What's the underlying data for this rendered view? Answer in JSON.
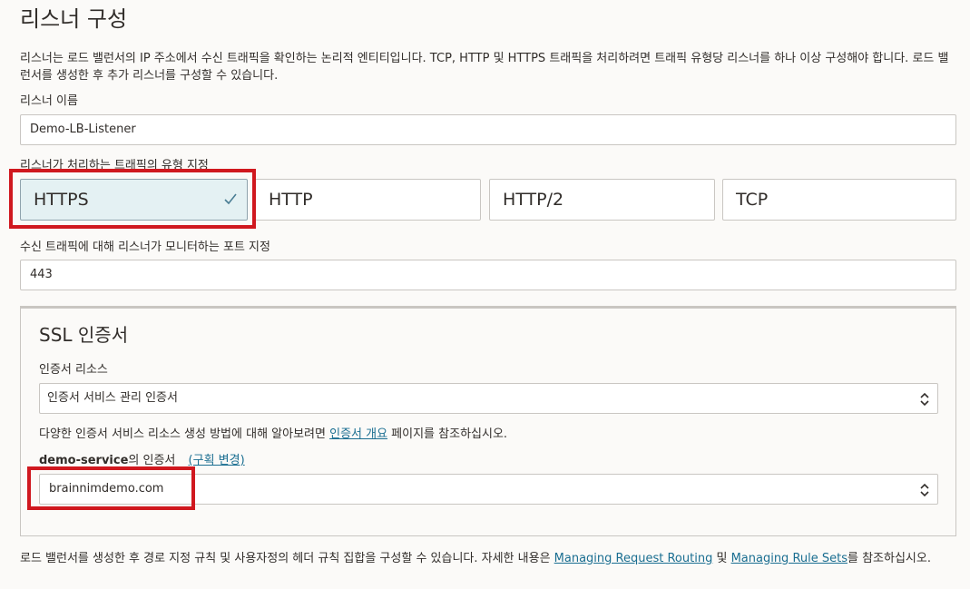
{
  "page": {
    "title": "리스너 구성",
    "description": "리스너는 로드 밸런서의 IP 주소에서 수신 트래픽을 확인하는 논리적 엔티티입니다. TCP, HTTP 및 HTTPS 트래픽을 처리하려면 트래픽 유형당 리스너를 하나 이상 구성해야 합니다. 로드 밸런서를 생성한 후 추가 리스너를 구성할 수 있습니다."
  },
  "listener_name": {
    "label": "리스너 이름",
    "value": "Demo-LB-Listener"
  },
  "traffic_type": {
    "label": "리스너가 처리하는 트래픽의 유형 지정",
    "options": [
      "HTTPS",
      "HTTP",
      "HTTP/2",
      "TCP"
    ],
    "selected": "HTTPS"
  },
  "port": {
    "label": "수신 트래픽에 대해 리스너가 모니터하는 포트 지정",
    "value": "443"
  },
  "ssl": {
    "title": "SSL 인증서",
    "resource_label": "인증서 리소스",
    "resource_value": "인증서 서비스 관리 인증서",
    "help_prefix": "다양한 인증서 서비스 리소스 생성 방법에 대해 알아보려면 ",
    "help_link": "인증서 개요",
    "help_suffix": " 페이지를 참조하십시오.",
    "compartment_name": "demo-service",
    "compartment_suffix": "의 인증서",
    "change_compartment": "(구획 변경)",
    "certificate_value": "brainnimdemo.com"
  },
  "footer": {
    "text_prefix": "로드 밸런서를 생성한 후 경로 지정 규칙 및 사용자정의 헤더 규칙 집합을 구성할 수 있습니다. 자세한 내용은 ",
    "link1": "Managing Request Routing",
    "middle": " 및 ",
    "link2": "Managing Rule Sets",
    "text_suffix": "를 참조하십시오."
  },
  "colors": {
    "highlight": "#d0181f",
    "link": "#1a6e91",
    "selected_tile": "#e4f1f3",
    "check": "#4a7d94"
  },
  "icons": {
    "selected_tile": "check-icon",
    "select": "chevron-updown-icon"
  }
}
